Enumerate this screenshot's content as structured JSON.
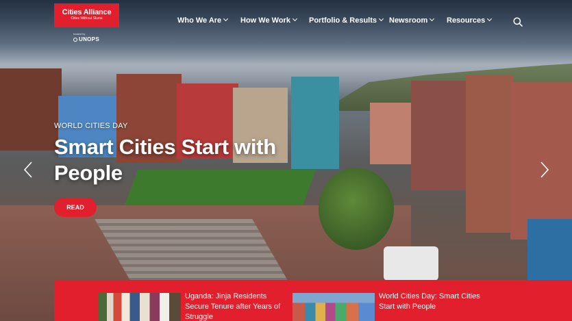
{
  "brand": {
    "logo_title": "Cities Alliance",
    "logo_subtitle": "Cities Without Slums",
    "hosted_by": "hosted by",
    "partner": "UNOPS"
  },
  "nav": {
    "items": [
      {
        "label": "Who We Are"
      },
      {
        "label": "How We Work"
      },
      {
        "label": "Portfolio & Results"
      },
      {
        "label": "Newsroom"
      },
      {
        "label": "Resources"
      }
    ]
  },
  "hero": {
    "eyebrow": "WORLD CITIES DAY",
    "headline": "Smart Cities Start with People",
    "cta_label": "READ"
  },
  "news": [
    {
      "title": "Uganda: Jinja Residents Secure Tenure after Years of Struggle"
    },
    {
      "title": "World Cities Day: Smart Cities Start with People"
    }
  ],
  "colors": {
    "brand_red": "#e21f2d"
  },
  "icons": {
    "search": "search-icon",
    "prev": "chevron-left-icon",
    "next": "chevron-right-icon"
  }
}
